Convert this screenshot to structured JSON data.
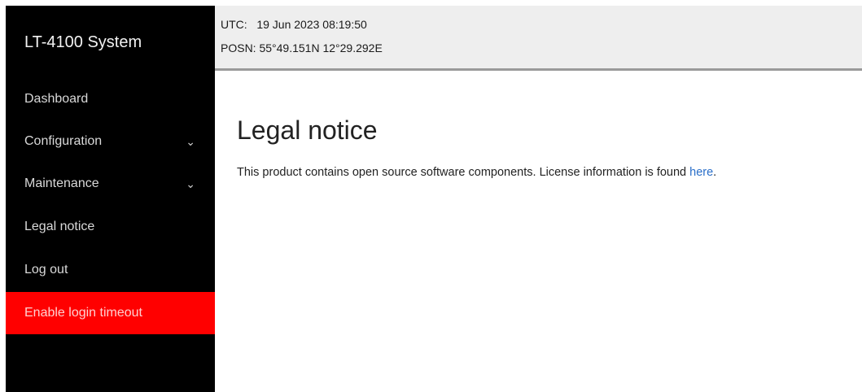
{
  "brand": {
    "title": "LT-4100 System"
  },
  "sidebar": {
    "items": [
      {
        "label": "Dashboard",
        "has_submenu": false
      },
      {
        "label": "Configuration",
        "has_submenu": true
      },
      {
        "label": "Maintenance",
        "has_submenu": true
      },
      {
        "label": "Legal notice",
        "has_submenu": false
      },
      {
        "label": "Log out",
        "has_submenu": false
      },
      {
        "label": "Enable login timeout",
        "has_submenu": false
      }
    ],
    "chevron_glyph": "⌄",
    "highlight_color": "#ff0000"
  },
  "status": {
    "utc_label": "UTC:",
    "utc_value": "19 Jun 2023 08:19:50",
    "posn_label": "POSN:",
    "posn_value": "55°49.151N 12°29.292E"
  },
  "main": {
    "title": "Legal notice",
    "notice_text": "This product contains open source software components. License information is found ",
    "link_text": "here",
    "notice_end": "."
  }
}
